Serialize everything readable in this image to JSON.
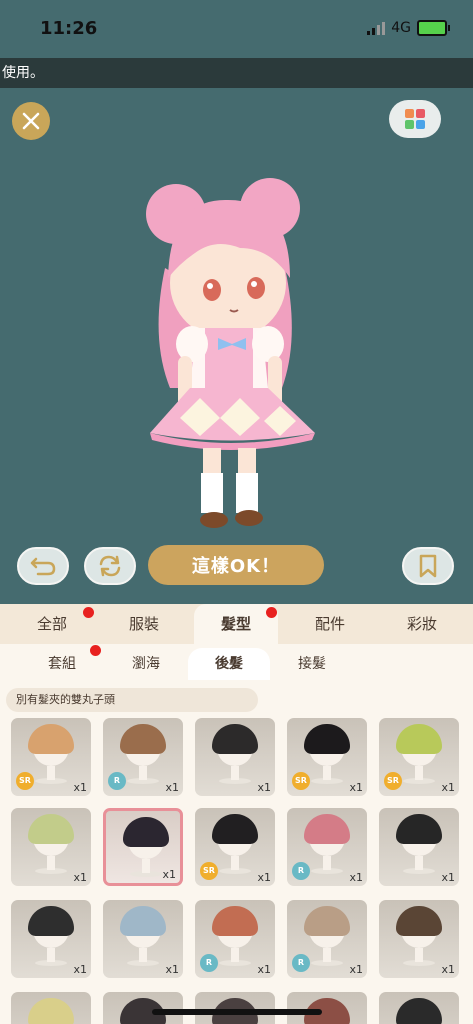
{
  "status": {
    "time": "11:26",
    "network": "4G"
  },
  "marquee": "使用。",
  "actions": {
    "ok_label": "這樣OK！"
  },
  "tabs": [
    {
      "label": "全部",
      "dot": false
    },
    {
      "label": "服裝",
      "dot": true
    },
    {
      "label": "髮型",
      "dot": true,
      "active": true
    },
    {
      "label": "配件",
      "dot": false
    },
    {
      "label": "彩妝",
      "dot": false
    }
  ],
  "subtabs": [
    {
      "label": "套組"
    },
    {
      "label": "瀏海"
    },
    {
      "label": "後髮",
      "active": true
    },
    {
      "label": "接髮"
    }
  ],
  "item_name": "別有髮夾的雙丸子頭",
  "items": [
    {
      "rarity": "SR",
      "qty": "x1",
      "hair": "#d8a26e"
    },
    {
      "rarity": "R",
      "qty": "x1",
      "hair": "#9a6d4c"
    },
    {
      "rarity": "",
      "qty": "x1",
      "hair": "#2c2a2a"
    },
    {
      "rarity": "SR",
      "qty": "x1",
      "hair": "#1c1a1c"
    },
    {
      "rarity": "SR",
      "qty": "x1",
      "hair": "#b8c95a"
    },
    {
      "rarity": "",
      "qty": "x1",
      "hair": "#c2cc8a"
    },
    {
      "rarity": "",
      "qty": "x1",
      "hair": "#2b2630",
      "selected": true
    },
    {
      "rarity": "SR",
      "qty": "x1",
      "hair": "#211f21"
    },
    {
      "rarity": "R",
      "qty": "x1",
      "hair": "#d47c87"
    },
    {
      "rarity": "",
      "qty": "x1",
      "hair": "#262626"
    },
    {
      "rarity": "",
      "qty": "x1",
      "hair": "#2e2e2e"
    },
    {
      "rarity": "",
      "qty": "x1",
      "hair": "#9fb7c8"
    },
    {
      "rarity": "R",
      "qty": "x1",
      "hair": "#c26d52"
    },
    {
      "rarity": "R",
      "qty": "x1",
      "hair": "#b99e86"
    },
    {
      "rarity": "",
      "qty": "x1",
      "hair": "#5a4535"
    },
    {
      "rarity": "",
      "qty": "",
      "hair": "#d9cf8a"
    },
    {
      "rarity": "",
      "qty": "",
      "hair": "#3a3436"
    },
    {
      "rarity": "",
      "qty": "",
      "hair": "#4a4040"
    },
    {
      "rarity": "",
      "qty": "",
      "hair": "#8c4f45"
    },
    {
      "rarity": "",
      "qty": "",
      "hair": "#2a2a2a"
    }
  ]
}
